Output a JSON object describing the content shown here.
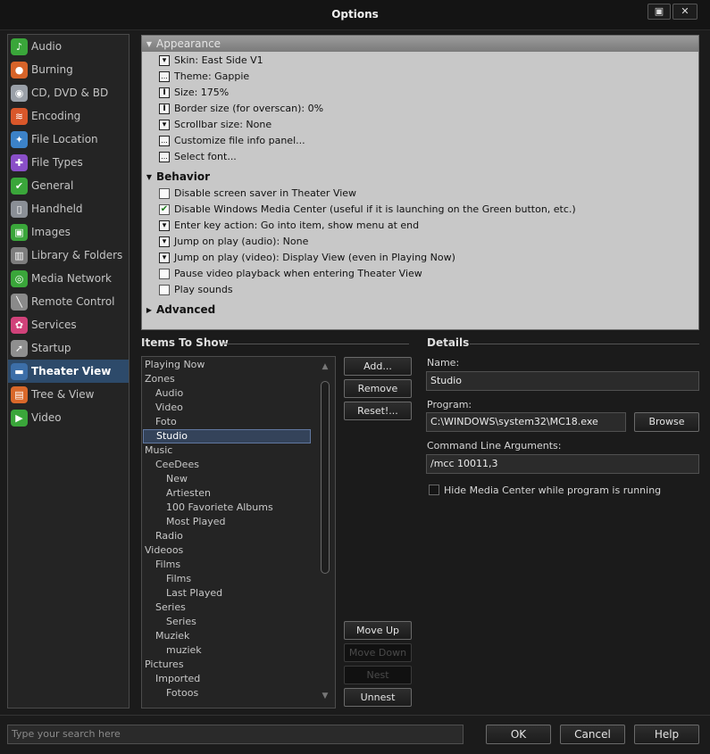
{
  "window": {
    "title": "Options",
    "restore_glyph": "▣",
    "close_glyph": "✕"
  },
  "sidebar": {
    "items": [
      {
        "label": "Audio",
        "icon": "audio-icon",
        "color": "#3aa63a",
        "glyph": "♪"
      },
      {
        "label": "Burning",
        "icon": "burning-icon",
        "color": "#d7642a",
        "glyph": "●"
      },
      {
        "label": "CD, DVD & BD",
        "icon": "disc-icon",
        "color": "#9aa0a8",
        "glyph": "◉"
      },
      {
        "label": "Encoding",
        "icon": "encoding-icon",
        "color": "#d9572a",
        "glyph": "≋"
      },
      {
        "label": "File Location",
        "icon": "compass-icon",
        "color": "#3c82c8",
        "glyph": "✦"
      },
      {
        "label": "File Types",
        "icon": "puzzle-icon",
        "color": "#8a4fc8",
        "glyph": "✚"
      },
      {
        "label": "General",
        "icon": "general-check-icon",
        "color": "#3aa63a",
        "glyph": "✔"
      },
      {
        "label": "Handheld",
        "icon": "handheld-icon",
        "color": "#8a8f96",
        "glyph": "▯"
      },
      {
        "label": "Images",
        "icon": "images-icon",
        "color": "#3aa63a",
        "glyph": "▣"
      },
      {
        "label": "Library & Folders",
        "icon": "library-icon",
        "color": "#7d7d7d",
        "glyph": "▥"
      },
      {
        "label": "Media Network",
        "icon": "network-icon",
        "color": "#3aa63a",
        "glyph": "◎"
      },
      {
        "label": "Remote Control",
        "icon": "remote-icon",
        "color": "#8a8a8a",
        "glyph": "╲"
      },
      {
        "label": "Services",
        "icon": "services-icon",
        "color": "#d1427a",
        "glyph": "✿"
      },
      {
        "label": "Startup",
        "icon": "startup-icon",
        "color": "#8f8f8f",
        "glyph": "➚"
      },
      {
        "label": "Theater View",
        "icon": "theater-view-icon",
        "color": "#3c6ea8",
        "glyph": "▬"
      },
      {
        "label": "Tree & View",
        "icon": "tree-view-icon",
        "color": "#d9682a",
        "glyph": "▤"
      },
      {
        "label": "Video",
        "icon": "video-icon",
        "color": "#3aa63a",
        "glyph": "▶"
      }
    ],
    "active_index": 14
  },
  "options": {
    "appearance_title": "Appearance",
    "appearance": [
      {
        "icon": "dd",
        "label": "Skin: East Side V1"
      },
      {
        "icon": "dots",
        "label": "Theme: Gappie"
      },
      {
        "icon": "cursor",
        "label": "Size: 175%"
      },
      {
        "icon": "cursor",
        "label": "Border size (for overscan): 0%"
      },
      {
        "icon": "dd",
        "label": "Scrollbar size: None"
      },
      {
        "icon": "dots",
        "label": "Customize file info panel..."
      },
      {
        "icon": "dots",
        "label": "Select font..."
      }
    ],
    "behavior_title": "Behavior",
    "behavior": [
      {
        "icon": "cb",
        "checked": false,
        "label": "Disable screen saver in Theater View"
      },
      {
        "icon": "cb",
        "checked": true,
        "label": "Disable Windows Media Center (useful if it is launching on the Green button, etc.)"
      },
      {
        "icon": "dd",
        "label": "Enter key action: Go into item, show menu at end"
      },
      {
        "icon": "dd",
        "label": "Jump on play (audio): None"
      },
      {
        "icon": "dd",
        "label": "Jump on play (video): Display View (even in Playing Now)"
      },
      {
        "icon": "cb",
        "checked": false,
        "label": "Pause video playback when entering Theater View"
      },
      {
        "icon": "cb",
        "checked": false,
        "label": "Play sounds"
      }
    ],
    "advanced_title": "Advanced"
  },
  "items_to_show": {
    "title": "Items To Show",
    "rows": [
      {
        "label": "Playing Now",
        "level": 0
      },
      {
        "label": "Zones",
        "level": 0
      },
      {
        "label": "Audio",
        "level": 1
      },
      {
        "label": "Video",
        "level": 1
      },
      {
        "label": "Foto",
        "level": 1
      },
      {
        "label": "Studio",
        "level": 1,
        "selected": true
      },
      {
        "label": "Music",
        "level": 0
      },
      {
        "label": "CeeDees",
        "level": 1
      },
      {
        "label": "New",
        "level": 2
      },
      {
        "label": "Artiesten",
        "level": 2
      },
      {
        "label": "100 Favoriete Albums",
        "level": 2
      },
      {
        "label": "Most Played",
        "level": 2
      },
      {
        "label": "Radio",
        "level": 1
      },
      {
        "label": "Videoos",
        "level": 0
      },
      {
        "label": "Films",
        "level": 1
      },
      {
        "label": "Films",
        "level": 2
      },
      {
        "label": "Last Played",
        "level": 2
      },
      {
        "label": "Series",
        "level": 1
      },
      {
        "label": "Series",
        "level": 2
      },
      {
        "label": "Muziek",
        "level": 1
      },
      {
        "label": "muziek",
        "level": 2
      },
      {
        "label": "Pictures",
        "level": 0
      },
      {
        "label": "Imported",
        "level": 1
      },
      {
        "label": "Fotoos",
        "level": 2
      }
    ],
    "scroll_up": "▲",
    "scroll_down": "▼"
  },
  "buttons": {
    "add": "Add...",
    "remove": "Remove",
    "reset": "Reset!...",
    "move_up": "Move Up",
    "move_down": "Move Down",
    "nest": "Nest",
    "unnest": "Unnest"
  },
  "details": {
    "title": "Details",
    "name_label": "Name:",
    "name_value": "Studio",
    "program_label": "Program:",
    "program_value": "C:\\WINDOWS\\system32\\MC18.exe",
    "browse": "Browse",
    "args_label": "Command Line Arguments:",
    "args_value": "/mcc 10011,3",
    "hide_label": "Hide Media Center while program is running",
    "hide_checked": false
  },
  "footer": {
    "search_placeholder": "Type your search here",
    "ok": "OK",
    "cancel": "Cancel",
    "help": "Help"
  }
}
